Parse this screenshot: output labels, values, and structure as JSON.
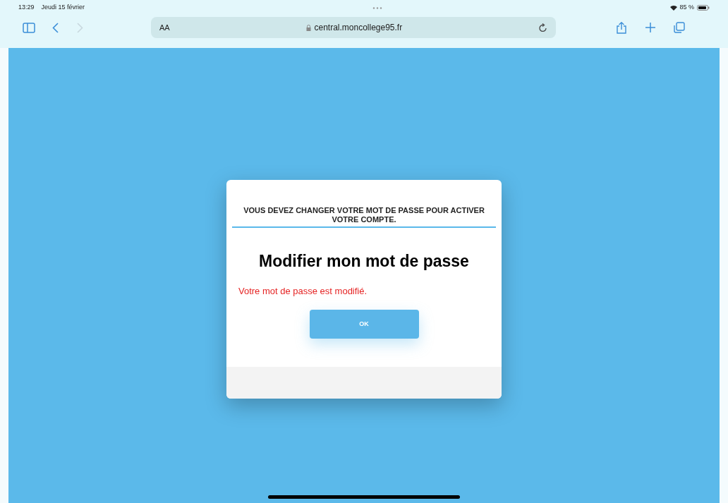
{
  "status_bar": {
    "time": "13:29",
    "date": "Jeudi 15 février",
    "battery_percent": "85 %"
  },
  "browser": {
    "text_size_button": "AA",
    "url": "central.moncollege95.fr"
  },
  "dialog": {
    "notice": "VOUS DEVEZ CHANGER VOTRE MOT DE PASSE POUR ACTIVER VOTRE COMPTE.",
    "title": "Modifier mon mot de passe",
    "message": "Votre mot de passe est modifié.",
    "button": "OK"
  }
}
